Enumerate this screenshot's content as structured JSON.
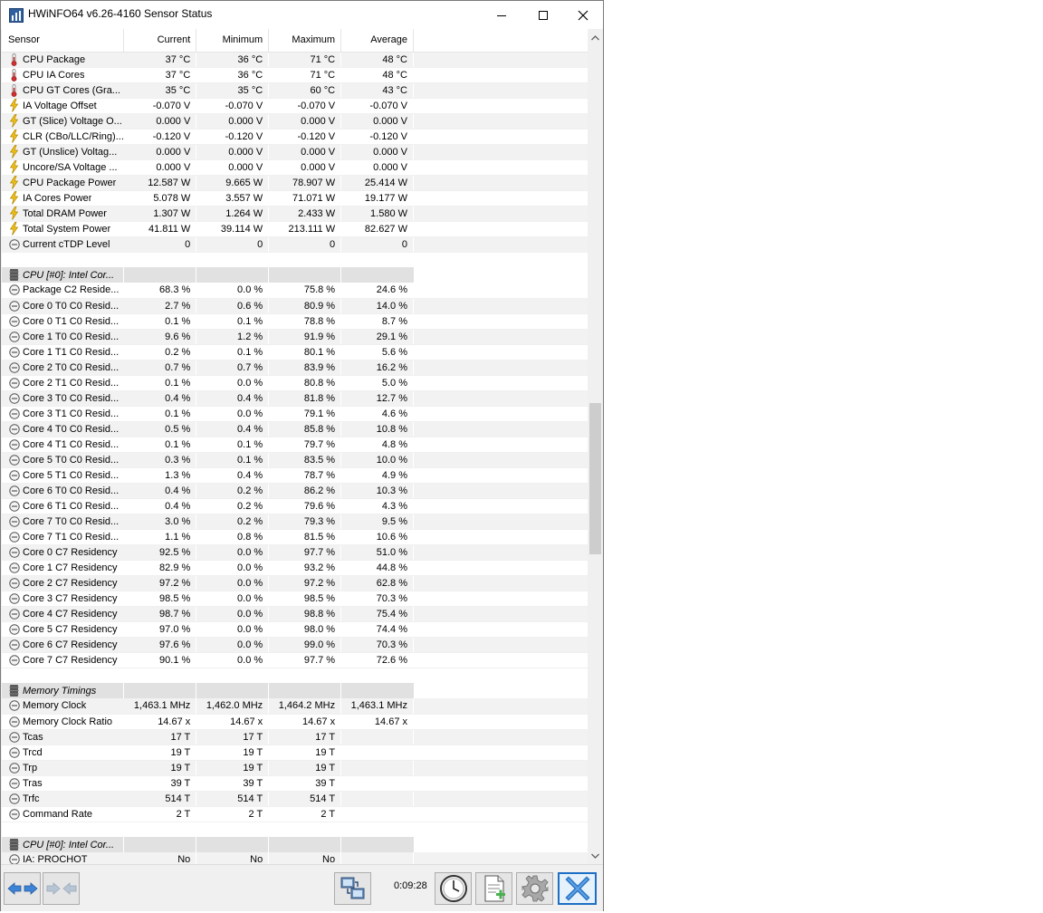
{
  "window": {
    "title": "HWiNFO64 v6.26-4160 Sensor Status",
    "controls": [
      "minimize",
      "maximize",
      "close"
    ]
  },
  "columns": [
    "Sensor",
    "Current",
    "Minimum",
    "Maximum",
    "Average"
  ],
  "rows": [
    {
      "type": "sensor",
      "icon": "thermometer-icon",
      "name": "CPU Package",
      "cur": "37 °C",
      "min": "36 °C",
      "max": "71 °C",
      "avg": "48 °C"
    },
    {
      "type": "sensor",
      "icon": "thermometer-icon",
      "name": "CPU IA Cores",
      "cur": "37 °C",
      "min": "36 °C",
      "max": "71 °C",
      "avg": "48 °C"
    },
    {
      "type": "sensor",
      "icon": "thermometer-icon",
      "name": "CPU GT Cores (Gra...",
      "cur": "35 °C",
      "min": "35 °C",
      "max": "60 °C",
      "avg": "43 °C"
    },
    {
      "type": "sensor",
      "icon": "lightning-icon",
      "name": "IA Voltage Offset",
      "cur": "-0.070 V",
      "min": "-0.070 V",
      "max": "-0.070 V",
      "avg": "-0.070 V"
    },
    {
      "type": "sensor",
      "icon": "lightning-icon",
      "name": "GT (Slice) Voltage O...",
      "cur": "0.000 V",
      "min": "0.000 V",
      "max": "0.000 V",
      "avg": "0.000 V"
    },
    {
      "type": "sensor",
      "icon": "lightning-icon",
      "name": "CLR (CBo/LLC/Ring)...",
      "cur": "-0.120 V",
      "min": "-0.120 V",
      "max": "-0.120 V",
      "avg": "-0.120 V"
    },
    {
      "type": "sensor",
      "icon": "lightning-icon",
      "name": "GT (Unslice) Voltag...",
      "cur": "0.000 V",
      "min": "0.000 V",
      "max": "0.000 V",
      "avg": "0.000 V"
    },
    {
      "type": "sensor",
      "icon": "lightning-icon",
      "name": "Uncore/SA Voltage ...",
      "cur": "0.000 V",
      "min": "0.000 V",
      "max": "0.000 V",
      "avg": "0.000 V"
    },
    {
      "type": "sensor",
      "icon": "lightning-icon",
      "name": "CPU Package Power",
      "cur": "12.587 W",
      "min": "9.665 W",
      "max": "78.907 W",
      "avg": "25.414 W"
    },
    {
      "type": "sensor",
      "icon": "lightning-icon",
      "name": "IA Cores Power",
      "cur": "5.078 W",
      "min": "3.557 W",
      "max": "71.071 W",
      "avg": "19.177 W"
    },
    {
      "type": "sensor",
      "icon": "lightning-icon",
      "name": "Total DRAM Power",
      "cur": "1.307 W",
      "min": "1.264 W",
      "max": "2.433 W",
      "avg": "1.580 W"
    },
    {
      "type": "sensor",
      "icon": "lightning-icon",
      "name": "Total System Power",
      "cur": "41.811 W",
      "min": "39.114 W",
      "max": "213.111 W",
      "avg": "82.627 W"
    },
    {
      "type": "sensor",
      "icon": "gauge-icon",
      "name": "Current cTDP Level",
      "cur": "0",
      "min": "0",
      "max": "0",
      "avg": "0"
    },
    {
      "type": "blank"
    },
    {
      "type": "group",
      "icon": "chip-icon",
      "name": "CPU [#0]: Intel Cor..."
    },
    {
      "type": "sensor",
      "icon": "gauge-icon",
      "name": "Package C2 Reside...",
      "cur": "68.3 %",
      "min": "0.0 %",
      "max": "75.8 %",
      "avg": "24.6 %"
    },
    {
      "type": "sensor",
      "icon": "gauge-icon",
      "name": "Core 0 T0 C0 Resid...",
      "cur": "2.7 %",
      "min": "0.6 %",
      "max": "80.9 %",
      "avg": "14.0 %"
    },
    {
      "type": "sensor",
      "icon": "gauge-icon",
      "name": "Core 0 T1 C0 Resid...",
      "cur": "0.1 %",
      "min": "0.1 %",
      "max": "78.8 %",
      "avg": "8.7 %"
    },
    {
      "type": "sensor",
      "icon": "gauge-icon",
      "name": "Core 1 T0 C0 Resid...",
      "cur": "9.6 %",
      "min": "1.2 %",
      "max": "91.9 %",
      "avg": "29.1 %"
    },
    {
      "type": "sensor",
      "icon": "gauge-icon",
      "name": "Core 1 T1 C0 Resid...",
      "cur": "0.2 %",
      "min": "0.1 %",
      "max": "80.1 %",
      "avg": "5.6 %"
    },
    {
      "type": "sensor",
      "icon": "gauge-icon",
      "name": "Core 2 T0 C0 Resid...",
      "cur": "0.7 %",
      "min": "0.7 %",
      "max": "83.9 %",
      "avg": "16.2 %"
    },
    {
      "type": "sensor",
      "icon": "gauge-icon",
      "name": "Core 2 T1 C0 Resid...",
      "cur": "0.1 %",
      "min": "0.0 %",
      "max": "80.8 %",
      "avg": "5.0 %"
    },
    {
      "type": "sensor",
      "icon": "gauge-icon",
      "name": "Core 3 T0 C0 Resid...",
      "cur": "0.4 %",
      "min": "0.4 %",
      "max": "81.8 %",
      "avg": "12.7 %"
    },
    {
      "type": "sensor",
      "icon": "gauge-icon",
      "name": "Core 3 T1 C0 Resid...",
      "cur": "0.1 %",
      "min": "0.0 %",
      "max": "79.1 %",
      "avg": "4.6 %"
    },
    {
      "type": "sensor",
      "icon": "gauge-icon",
      "name": "Core 4 T0 C0 Resid...",
      "cur": "0.5 %",
      "min": "0.4 %",
      "max": "85.8 %",
      "avg": "10.8 %"
    },
    {
      "type": "sensor",
      "icon": "gauge-icon",
      "name": "Core 4 T1 C0 Resid...",
      "cur": "0.1 %",
      "min": "0.1 %",
      "max": "79.7 %",
      "avg": "4.8 %"
    },
    {
      "type": "sensor",
      "icon": "gauge-icon",
      "name": "Core 5 T0 C0 Resid...",
      "cur": "0.3 %",
      "min": "0.1 %",
      "max": "83.5 %",
      "avg": "10.0 %"
    },
    {
      "type": "sensor",
      "icon": "gauge-icon",
      "name": "Core 5 T1 C0 Resid...",
      "cur": "1.3 %",
      "min": "0.4 %",
      "max": "78.7 %",
      "avg": "4.9 %"
    },
    {
      "type": "sensor",
      "icon": "gauge-icon",
      "name": "Core 6 T0 C0 Resid...",
      "cur": "0.4 %",
      "min": "0.2 %",
      "max": "86.2 %",
      "avg": "10.3 %"
    },
    {
      "type": "sensor",
      "icon": "gauge-icon",
      "name": "Core 6 T1 C0 Resid...",
      "cur": "0.4 %",
      "min": "0.2 %",
      "max": "79.6 %",
      "avg": "4.3 %"
    },
    {
      "type": "sensor",
      "icon": "gauge-icon",
      "name": "Core 7 T0 C0 Resid...",
      "cur": "3.0 %",
      "min": "0.2 %",
      "max": "79.3 %",
      "avg": "9.5 %"
    },
    {
      "type": "sensor",
      "icon": "gauge-icon",
      "name": "Core 7 T1 C0 Resid...",
      "cur": "1.1 %",
      "min": "0.8 %",
      "max": "81.5 %",
      "avg": "10.6 %"
    },
    {
      "type": "sensor",
      "icon": "gauge-icon",
      "name": "Core 0 C7 Residency",
      "cur": "92.5 %",
      "min": "0.0 %",
      "max": "97.7 %",
      "avg": "51.0 %"
    },
    {
      "type": "sensor",
      "icon": "gauge-icon",
      "name": "Core 1 C7 Residency",
      "cur": "82.9 %",
      "min": "0.0 %",
      "max": "93.2 %",
      "avg": "44.8 %"
    },
    {
      "type": "sensor",
      "icon": "gauge-icon",
      "name": "Core 2 C7 Residency",
      "cur": "97.2 %",
      "min": "0.0 %",
      "max": "97.2 %",
      "avg": "62.8 %"
    },
    {
      "type": "sensor",
      "icon": "gauge-icon",
      "name": "Core 3 C7 Residency",
      "cur": "98.5 %",
      "min": "0.0 %",
      "max": "98.5 %",
      "avg": "70.3 %"
    },
    {
      "type": "sensor",
      "icon": "gauge-icon",
      "name": "Core 4 C7 Residency",
      "cur": "98.7 %",
      "min": "0.0 %",
      "max": "98.8 %",
      "avg": "75.4 %"
    },
    {
      "type": "sensor",
      "icon": "gauge-icon",
      "name": "Core 5 C7 Residency",
      "cur": "97.0 %",
      "min": "0.0 %",
      "max": "98.0 %",
      "avg": "74.4 %"
    },
    {
      "type": "sensor",
      "icon": "gauge-icon",
      "name": "Core 6 C7 Residency",
      "cur": "97.6 %",
      "min": "0.0 %",
      "max": "99.0 %",
      "avg": "70.3 %"
    },
    {
      "type": "sensor",
      "icon": "gauge-icon",
      "name": "Core 7 C7 Residency",
      "cur": "90.1 %",
      "min": "0.0 %",
      "max": "97.7 %",
      "avg": "72.6 %"
    },
    {
      "type": "blank"
    },
    {
      "type": "group",
      "icon": "chip-icon",
      "name": "Memory Timings"
    },
    {
      "type": "sensor",
      "icon": "gauge-icon",
      "name": "Memory Clock",
      "cur": "1,463.1 MHz",
      "min": "1,462.0 MHz",
      "max": "1,464.2 MHz",
      "avg": "1,463.1 MHz"
    },
    {
      "type": "sensor",
      "icon": "gauge-icon",
      "name": "Memory Clock Ratio",
      "cur": "14.67 x",
      "min": "14.67 x",
      "max": "14.67 x",
      "avg": "14.67 x"
    },
    {
      "type": "sensor",
      "icon": "gauge-icon",
      "name": "Tcas",
      "cur": "17 T",
      "min": "17 T",
      "max": "17 T",
      "avg": ""
    },
    {
      "type": "sensor",
      "icon": "gauge-icon",
      "name": "Trcd",
      "cur": "19 T",
      "min": "19 T",
      "max": "19 T",
      "avg": ""
    },
    {
      "type": "sensor",
      "icon": "gauge-icon",
      "name": "Trp",
      "cur": "19 T",
      "min": "19 T",
      "max": "19 T",
      "avg": ""
    },
    {
      "type": "sensor",
      "icon": "gauge-icon",
      "name": "Tras",
      "cur": "39 T",
      "min": "39 T",
      "max": "39 T",
      "avg": ""
    },
    {
      "type": "sensor",
      "icon": "gauge-icon",
      "name": "Trfc",
      "cur": "514 T",
      "min": "514 T",
      "max": "514 T",
      "avg": ""
    },
    {
      "type": "sensor",
      "icon": "gauge-icon",
      "name": "Command Rate",
      "cur": "2 T",
      "min": "2 T",
      "max": "2 T",
      "avg": ""
    },
    {
      "type": "blank"
    },
    {
      "type": "group",
      "icon": "chip-icon",
      "name": "CPU [#0]: Intel Cor..."
    },
    {
      "type": "sensor",
      "icon": "gauge-icon",
      "name": "IA: PROCHOT",
      "cur": "No",
      "min": "No",
      "max": "No",
      "avg": ""
    }
  ],
  "toolbar": {
    "elapsed_time": "0:09:28",
    "buttons": [
      "navigate-arrows-icon",
      "navigate-arrows-disabled-icon",
      "network-icon",
      "clock-icon",
      "add-report-icon",
      "settings-gear-icon",
      "close-x-icon"
    ]
  },
  "colors": {
    "group_row": "#e1e1e1",
    "alt_row": "#f2f2f2",
    "close_button": "#1c6fc4"
  }
}
